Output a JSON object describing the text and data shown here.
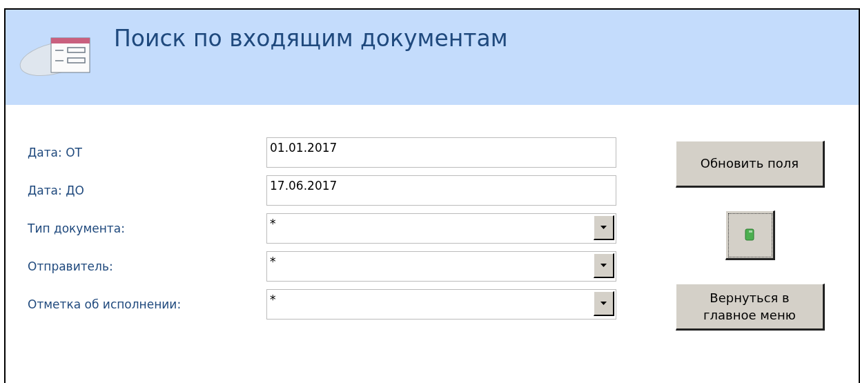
{
  "header": {
    "title": "Поиск по входящим документам"
  },
  "fields": [
    {
      "label": "Дата: ОТ",
      "kind": "text",
      "value": "01.01.2017"
    },
    {
      "label": "Дата: ДО",
      "kind": "text",
      "value": "17.06.2017"
    },
    {
      "label": "Тип документа:",
      "kind": "combo",
      "value": "*"
    },
    {
      "label": "Отправитель:",
      "kind": "combo",
      "value": "*"
    },
    {
      "label": "Отметка об исполнении:",
      "kind": "combo",
      "value": "*"
    }
  ],
  "buttons": [
    {
      "kind": "text",
      "label": "Обновить поля"
    },
    {
      "kind": "icon"
    },
    {
      "kind": "text",
      "label": "Вернуться в главное меню"
    }
  ]
}
